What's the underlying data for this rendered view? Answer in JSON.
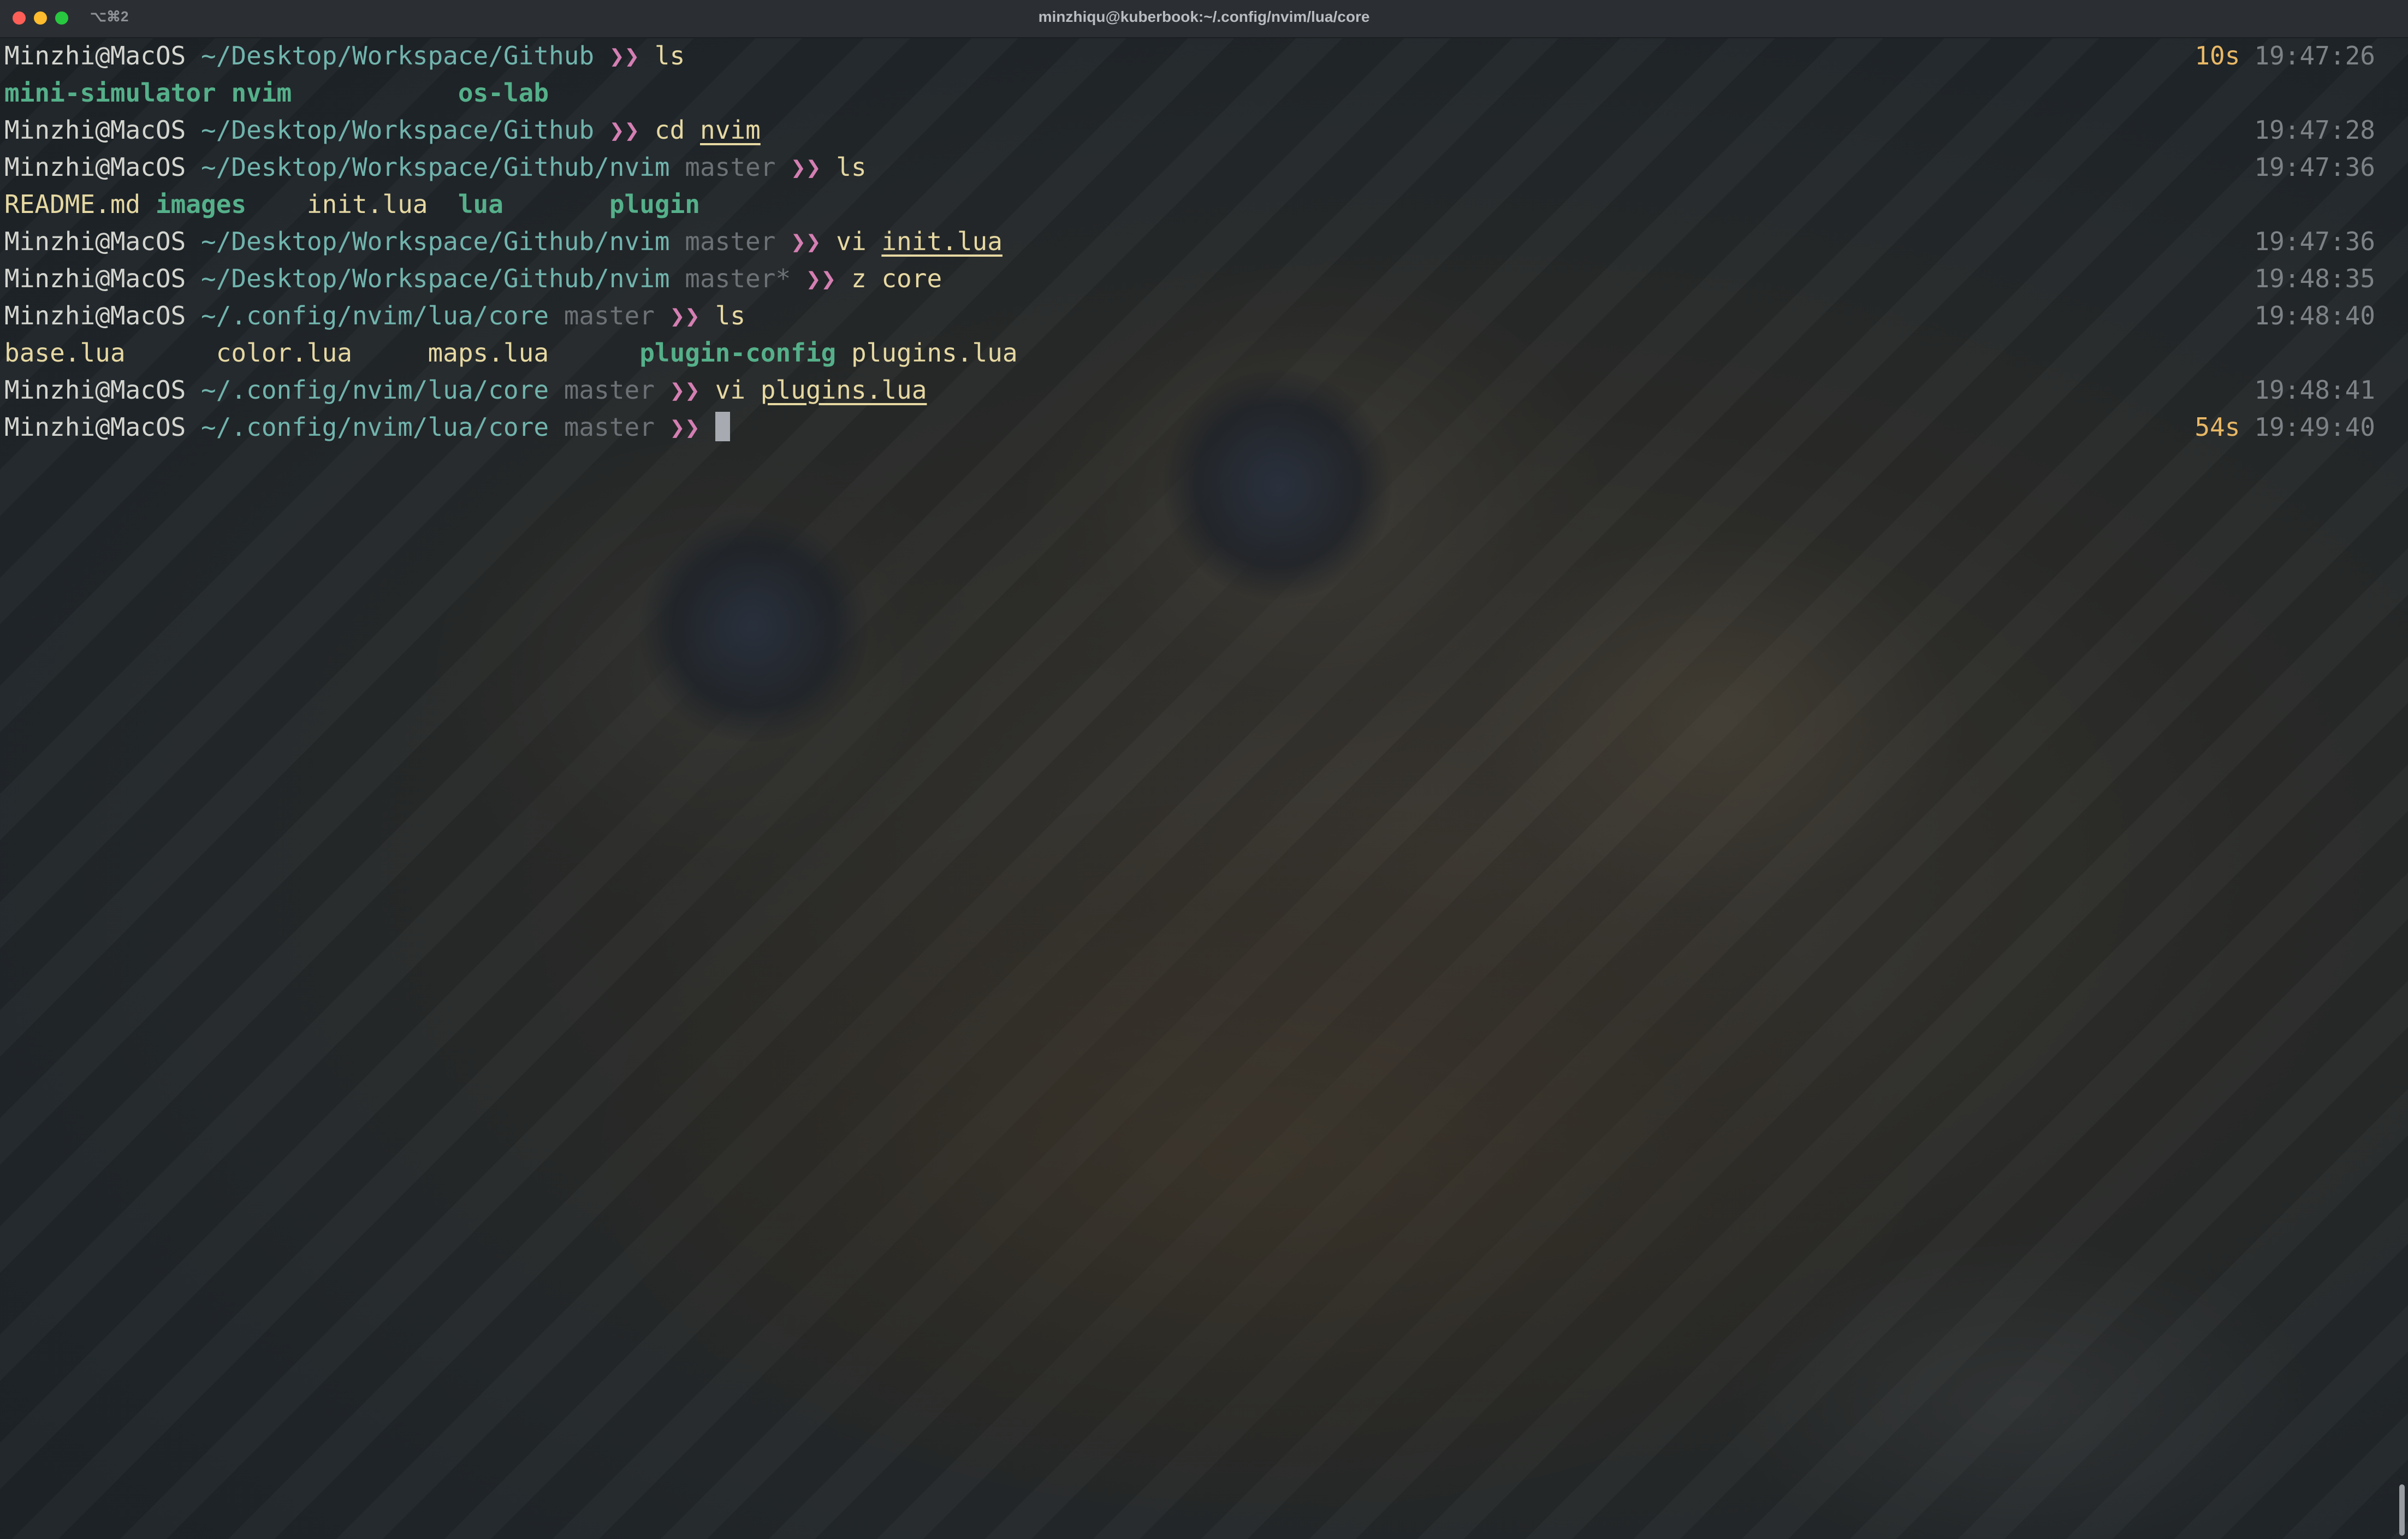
{
  "window": {
    "title": "minzhiqu@kuberbook:~/.config/nvim/lua/core",
    "shortcut": "⌥⌘2"
  },
  "colors": {
    "user": "#d4d5cf",
    "path": "#71b4ad",
    "branch": "#6c7176",
    "prompt_arrow": "#d47fb3",
    "command": "#e6d8a2",
    "directory": "#55b08a",
    "duration": "#e8b866",
    "time": "#7d8287"
  },
  "prompt": {
    "user": "Minzhi@MacOS",
    "arrow": "❯❯"
  },
  "lines": [
    {
      "path": "~/Desktop/Workspace/Github",
      "branch": "",
      "cmd": "ls",
      "arg": "",
      "duration": "10s",
      "time": "19:47:26"
    },
    {
      "output": [
        "mini-simulator",
        "nvim",
        "os-lab"
      ]
    },
    {
      "path": "~/Desktop/Workspace/Github",
      "branch": "",
      "cmd": "cd",
      "arg": "nvim",
      "duration": "",
      "time": "19:47:28"
    },
    {
      "path": "~/Desktop/Workspace/Github/nvim",
      "branch": "master",
      "cmd": "ls",
      "arg": "",
      "duration": "",
      "time": "19:47:36"
    },
    {
      "output": [
        "README.md",
        "images",
        "init.lua",
        "lua",
        "plugin"
      ]
    },
    {
      "path": "~/Desktop/Workspace/Github/nvim",
      "branch": "master",
      "cmd": "vi",
      "arg": "init.lua",
      "duration": "",
      "time": "19:47:36"
    },
    {
      "path": "~/Desktop/Workspace/Github/nvim",
      "branch": "master*",
      "cmd": "z",
      "arg": "core",
      "duration": "",
      "time": "19:48:35"
    },
    {
      "path": "~/.config/nvim/lua/core",
      "branch": "master",
      "cmd": "ls",
      "arg": "",
      "duration": "",
      "time": "19:48:40"
    },
    {
      "output": [
        "base.lua",
        "color.lua",
        "maps.lua",
        "plugin-config",
        "plugins.lua"
      ]
    },
    {
      "path": "~/.config/nvim/lua/core",
      "branch": "master",
      "cmd": "vi",
      "arg": "plugins.lua",
      "duration": "",
      "time": "19:48:41"
    },
    {
      "path": "~/.config/nvim/lua/core",
      "branch": "master",
      "cmd": "",
      "arg": "",
      "duration": "54s",
      "time": "19:49:40"
    }
  ]
}
